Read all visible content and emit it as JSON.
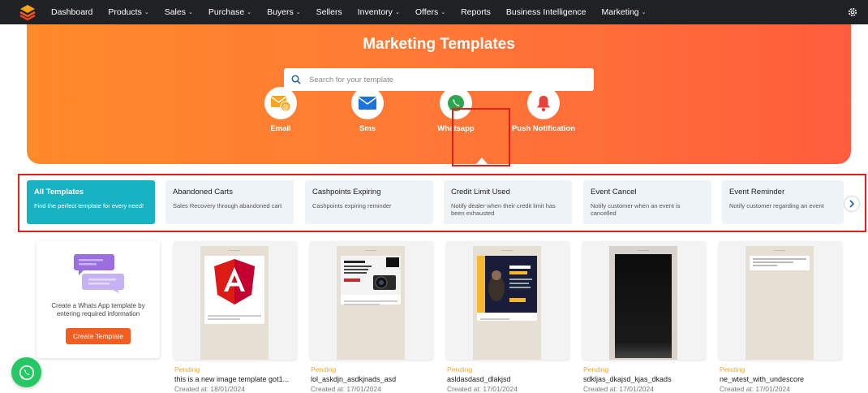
{
  "nav": {
    "items": [
      {
        "label": "Dashboard",
        "dropdown": false
      },
      {
        "label": "Products",
        "dropdown": true
      },
      {
        "label": "Sales",
        "dropdown": true
      },
      {
        "label": "Purchase",
        "dropdown": true
      },
      {
        "label": "Buyers",
        "dropdown": true
      },
      {
        "label": "Sellers",
        "dropdown": false
      },
      {
        "label": "Inventory",
        "dropdown": true
      },
      {
        "label": "Offers",
        "dropdown": true
      },
      {
        "label": "Reports",
        "dropdown": false
      },
      {
        "label": "Business Intelligence",
        "dropdown": false
      },
      {
        "label": "Marketing",
        "dropdown": true
      }
    ],
    "settings_icon": "gear-icon"
  },
  "hero": {
    "title": "Marketing Templates",
    "search_placeholder": "Search for your template"
  },
  "channels": [
    {
      "label": "Email",
      "icon": "email-icon"
    },
    {
      "label": "Sms",
      "icon": "envelope-icon"
    },
    {
      "label": "Whatsapp",
      "icon": "whatsapp-icon",
      "selected": true
    },
    {
      "label": "Push Notification",
      "icon": "bell-icon"
    }
  ],
  "categories": [
    {
      "title": "All Templates",
      "desc": "Find the perfect template for every need!",
      "active": true
    },
    {
      "title": "Abandoned Carts",
      "desc": "Sales Recovery through abandoned cart"
    },
    {
      "title": "Cashpoints Expiring",
      "desc": "Cashpoints expiring reminder"
    },
    {
      "title": "Credit Limit Used",
      "desc": "Notify dealer when their credit limit has been exhausted"
    },
    {
      "title": "Event Cancel",
      "desc": "Notify customer when an event is cancelled"
    },
    {
      "title": "Event Reminder",
      "desc": "Notify customer regarding an event"
    }
  ],
  "create_card": {
    "text": "Create a Whats App template by entering required information",
    "button": "Create Template"
  },
  "templates": [
    {
      "status": "Pending",
      "name": "this is a new image template got1...",
      "created": "Created at: 18/01/2024"
    },
    {
      "status": "Pending",
      "name": "lol_askdjn_asdkjnads_asd",
      "created": "Created at: 17/01/2024"
    },
    {
      "status": "Pending",
      "name": "asldasdasd_dlakjsd",
      "created": "Created at: 17/01/2024"
    },
    {
      "status": "Pending",
      "name": "sdkljas_dkajsd_kjas_dkads",
      "created": "Created at: 17/01/2024"
    },
    {
      "status": "Pending",
      "name": "ne_wtest_with_undescore",
      "created": "Created at: 17/01/2024"
    }
  ],
  "colors": {
    "accent": "#17b3c2",
    "hero_start": "#ff8a2a",
    "hero_end": "#ff5d3c",
    "button": "#f25d22",
    "pending": "#f2a52b",
    "nav_bg": "#202124",
    "highlight": "#e0211b"
  }
}
